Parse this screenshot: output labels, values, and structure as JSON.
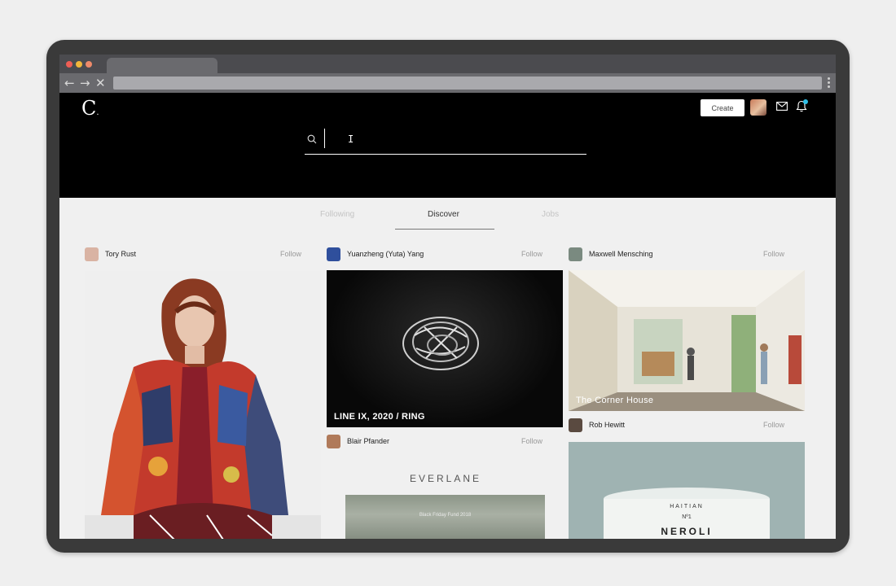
{
  "brand": {
    "logo": "C",
    "logo_dot": "."
  },
  "toolbar": {
    "create_label": "Create"
  },
  "search": {
    "placeholder": "",
    "value": ""
  },
  "tabs": [
    {
      "label": "Following",
      "active": false
    },
    {
      "label": "Discover",
      "active": true
    },
    {
      "label": "Jobs",
      "active": false
    }
  ],
  "feed": {
    "follow_label": "Follow",
    "posts": [
      {
        "author": "Tory Rust",
        "avatar_color": "#d9b3a3"
      },
      {
        "author": "Yuanzheng (Yuta) Yang",
        "avatar_color": "#2f4f9c",
        "card_title": "LINE IX, 2020 / RING"
      },
      {
        "author": "Maxwell Mensching",
        "avatar_color": "#7a8a80",
        "card_title": "The Corner House"
      },
      {
        "author": "Blair Pfander",
        "avatar_color": "#b07a5a",
        "brand_logo": "EVERLANE",
        "image_caption": "Black Friday Fund 2018"
      },
      {
        "author": "Rob Hewitt",
        "avatar_color": "#5a4a40",
        "mug_top": "HAITIAN",
        "mug_num": "Nº1",
        "mug_name": "NEROLI"
      }
    ]
  },
  "colors": {
    "header_bg": "#000000",
    "page_bg": "#f0f0f0",
    "accent": "#2fc0e8"
  }
}
